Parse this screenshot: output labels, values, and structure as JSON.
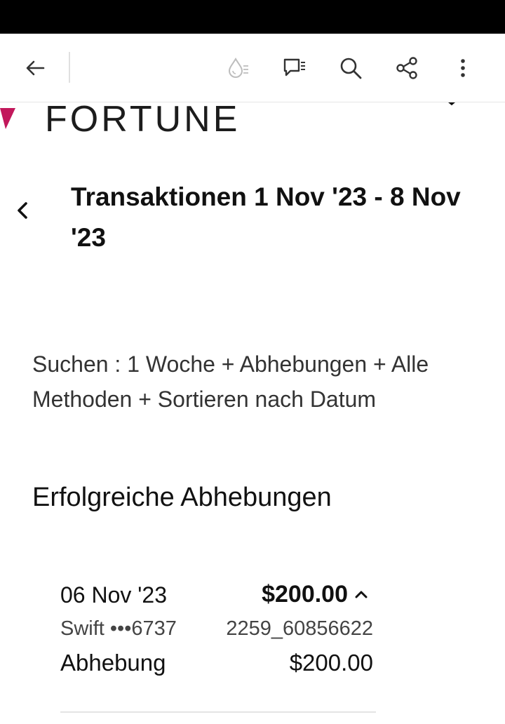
{
  "colors": {
    "status_bar": "#000000",
    "brand_mark": "#c2185b",
    "text_primary": "#111111",
    "text_secondary": "#444444",
    "icon": "#333333"
  },
  "toolbar": {
    "icons": [
      "back-arrow-icon",
      "ink-drop-icon",
      "comment-list-icon",
      "search-icon",
      "share-icon",
      "more-vert-icon"
    ]
  },
  "brand": {
    "name": "FORTUNE"
  },
  "page": {
    "title": "Transaktionen 1 Nov '23 - 8 Nov '23",
    "filter": "Suchen : 1 Woche + Abhebungen + Alle Methoden + Sortieren nach Datum",
    "section_heading": "Erfolgreiche Abhebungen"
  },
  "transactions": [
    {
      "date": "06 Nov '23",
      "amount": "$200.00",
      "method": "Swift •••6737",
      "reference": "2259_60856622",
      "type": "Abhebung",
      "type_amount": "$200.00"
    }
  ]
}
